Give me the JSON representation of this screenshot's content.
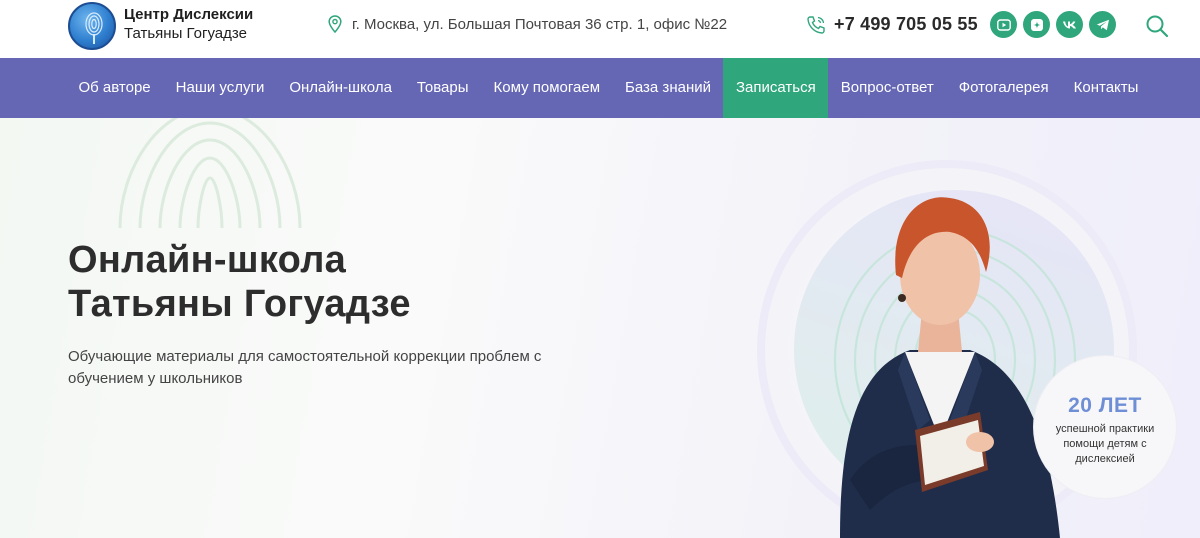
{
  "header": {
    "brand_line1": "Центр Дислексии",
    "brand_line2": "Татьяны Гогуадзе",
    "address": "г. Москва, ул. Большая Почтовая 36 стр. 1, офис №22",
    "phone": "+7 499 705 05 55",
    "socials": [
      "youtube-icon",
      "zen-icon",
      "vk-icon",
      "telegram-icon"
    ],
    "search_icon": "search-icon"
  },
  "nav": {
    "items": [
      {
        "label": "Об авторе"
      },
      {
        "label": "Наши услуги"
      },
      {
        "label": "Онлайн-школа"
      },
      {
        "label": "Товары"
      },
      {
        "label": "Кому помогаем"
      },
      {
        "label": "База знаний"
      },
      {
        "label": "Записаться",
        "active": true
      },
      {
        "label": "Вопрос-ответ"
      },
      {
        "label": "Фотогалерея"
      },
      {
        "label": "Контакты"
      }
    ]
  },
  "hero": {
    "title_line1": "Онлайн-школа",
    "title_line2": "Татьяны Гогуадзе",
    "subtitle": "Обучающие материалы для самостоятельной коррекции проблем с обучением у школьников",
    "badge_big": "20 ЛЕТ",
    "badge_small": "успешной практики помощи детям с дислексией"
  },
  "colors": {
    "nav_bg": "#6667b4",
    "accent_green": "#2fa67c",
    "badge_blue": "#6e8fd6"
  }
}
